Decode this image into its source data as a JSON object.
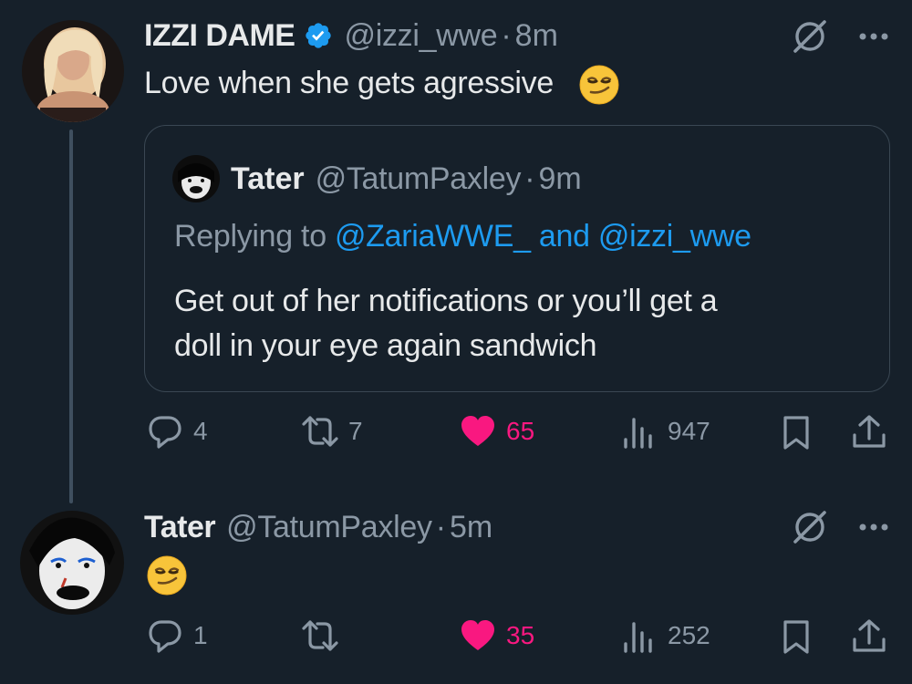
{
  "tweet1": {
    "author_name": "IZZI DAME",
    "handle": "@izzi_wwe",
    "separator": "·",
    "time": "8m",
    "text": "Love when she gets agressive",
    "emoji": "smirking-face",
    "quote": {
      "author_name": "Tater",
      "handle": "@TatumPaxley",
      "separator": "·",
      "time": "9m",
      "replying_prefix": "Replying to",
      "mention1": "@ZariaWWE_",
      "conjunction": "and",
      "mention2": "@izzi_wwe",
      "text_line1": "Get out of her notifications or you’ll get a",
      "text_line2": "doll in your eye again sandwich"
    },
    "actions": {
      "replies": "4",
      "retweets": "7",
      "likes": "65",
      "views": "947"
    }
  },
  "tweet2": {
    "author_name": "Tater",
    "handle": "@TatumPaxley",
    "separator": "·",
    "time": "5m",
    "emoji": "smirking-face",
    "actions": {
      "replies": "1",
      "retweets": "",
      "likes": "35",
      "views": "252"
    }
  },
  "colors": {
    "background": "#16202a",
    "accent": "#1d9bf0",
    "like": "#f91880",
    "secondary_text": "#8b98a5"
  }
}
